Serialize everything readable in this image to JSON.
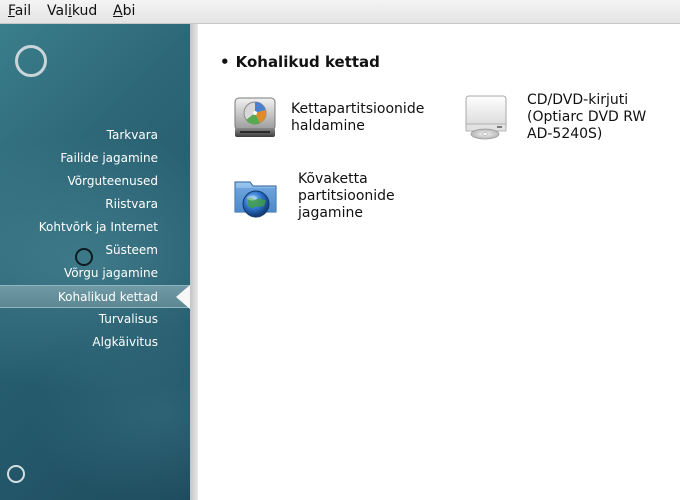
{
  "menubar": {
    "items": [
      {
        "mnemonic": "F",
        "rest": "ail"
      },
      {
        "pre": "Val",
        "mnemonic": "i",
        "rest": "kud"
      },
      {
        "mnemonic": "A",
        "rest": "bi"
      }
    ]
  },
  "sidebar": {
    "items": [
      {
        "label": "Tarkvara"
      },
      {
        "label": "Failide jagamine"
      },
      {
        "label": "Võrguteenused"
      },
      {
        "label": "Riistvara"
      },
      {
        "label": "Kohtvõrk ja Internet"
      },
      {
        "label": "Süsteem"
      },
      {
        "label": "Võrgu jagamine"
      },
      {
        "label": "Kohalikud kettad"
      },
      {
        "label": "Turvalisus"
      },
      {
        "label": "Algkäivitus"
      }
    ],
    "active_index": 7
  },
  "content": {
    "section_title": "Kohalikud kettad",
    "tiles": [
      {
        "label_line1": "Kettapartitsioonide",
        "label_line2": "haldamine",
        "icon": "hard-disk-icon"
      },
      {
        "label_line1": "CD/DVD-kirjuti",
        "label_line2": "(Optiarc DVD RW",
        "label_line3": "AD-5240S)",
        "icon": "optical-drive-icon"
      },
      {
        "label_line1": "Kõvaketta",
        "label_line2": "partitsioonide",
        "label_line3": "jagamine",
        "icon": "shared-folder-icon"
      }
    ]
  },
  "colors": {
    "sidebar_bg": "#2e6878",
    "active_item": "#5d8893",
    "content_bg": "#ffffff"
  }
}
